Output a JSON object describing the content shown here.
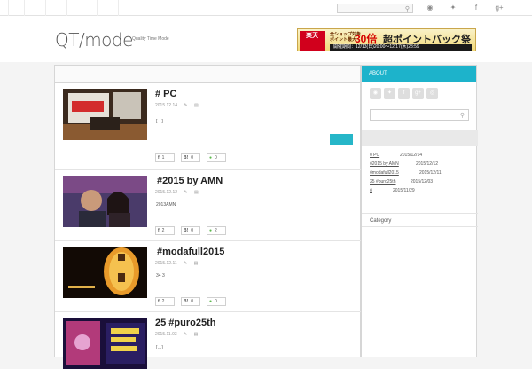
{
  "topbar": {
    "icons": [
      "rss-icon",
      "twitter-icon",
      "facebook-icon",
      "googleplus-icon"
    ],
    "search_placeholder": ""
  },
  "header": {
    "logo": "QT/mode",
    "tagline": "Quality Time Mode"
  },
  "banner": {
    "brand": "楽天",
    "line1": "全ショップ対象",
    "line1b": "ポイント最大",
    "big": "30倍",
    "title": "超ポイントバック祭",
    "period": "開催期間：12/13(日)20:00～12/17(木)23:59"
  },
  "posts": [
    {
      "title": "# PC",
      "date": "2015.12.14",
      "excerpt": "[…]",
      "has_more": true,
      "shares": {
        "facebook": "1",
        "hatena": "0",
        "comment": "0"
      },
      "thumb": "presentation-stage-photo"
    },
    {
      "title": "#2015 by AMN",
      "date": "2015.12.12",
      "excerpt": "2013AMN",
      "has_more": false,
      "shares": {
        "facebook": "2",
        "hatena": "0",
        "comment": "2"
      },
      "thumb": "selfie-photo"
    },
    {
      "title": "#modafull2015",
      "date": "2015.12.11",
      "excerpt": "34 3",
      "has_more": false,
      "shares": {
        "facebook": "2",
        "hatena": "0",
        "comment": "0"
      },
      "thumb": "lantern-photo"
    },
    {
      "title": "25 #puro25th",
      "date": "2015.11.03",
      "excerpt": "[…]",
      "has_more": false,
      "shares": {
        "facebook": "",
        "hatena": "",
        "comment": ""
      },
      "thumb": "parade-photo"
    }
  ],
  "sidebar": {
    "about_label": "ABOUT",
    "icons": [
      "rss-icon",
      "twitter-icon",
      "facebook-icon",
      "googleplus-icon",
      "feed-icon"
    ],
    "recent": [
      {
        "title": "# PC",
        "date": "2015/12/14"
      },
      {
        "title": "#2015 by AMN",
        "date": "2015/12/12"
      },
      {
        "title": "#modafull2015",
        "date": "2015/12/11"
      },
      {
        "title": "25 #puro25th",
        "date": "2015/12/03"
      },
      {
        "title": "#",
        "date": "2015/11/29"
      }
    ],
    "category_label": "Category"
  },
  "colors": {
    "accent": "#1db3cb",
    "more_button": "#26b6c8"
  }
}
